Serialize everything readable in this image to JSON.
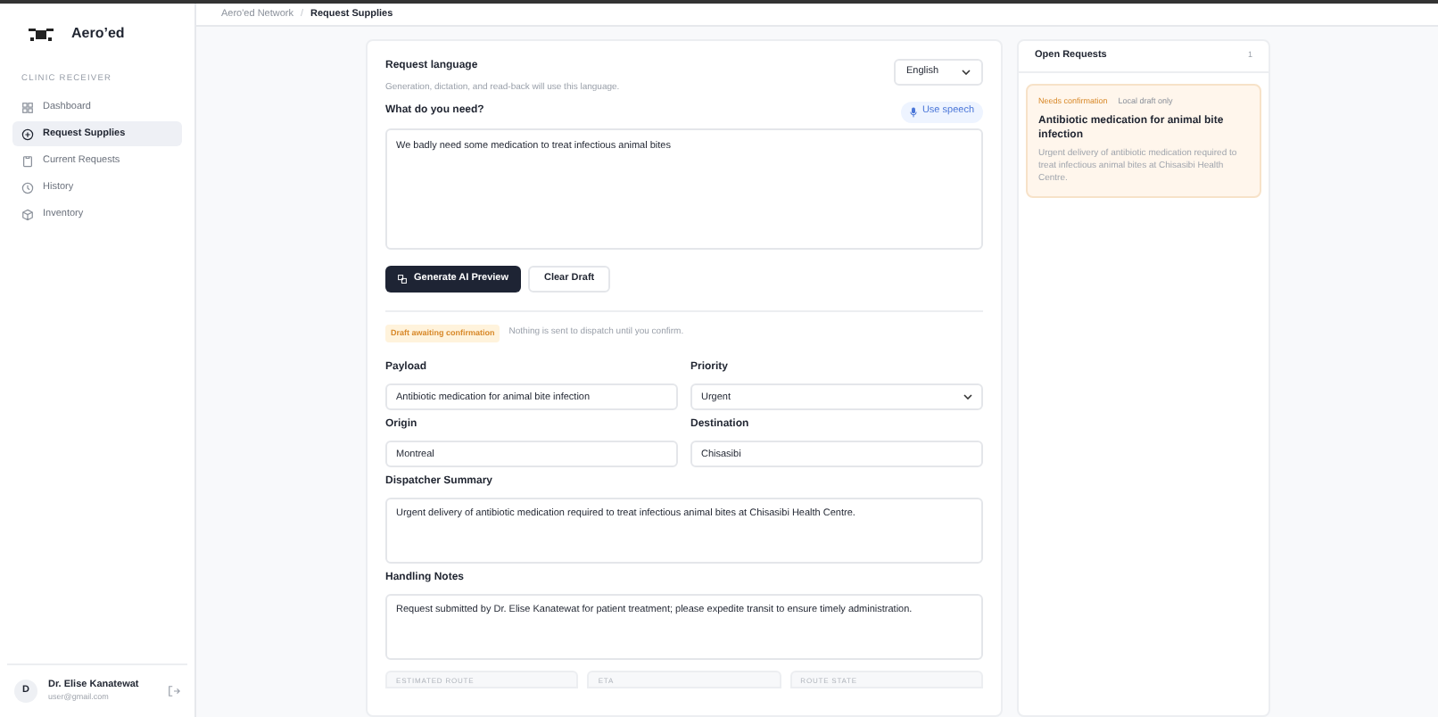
{
  "app": {
    "name": "Aero’ed"
  },
  "sidebar": {
    "section": "CLINIC RECEIVER",
    "items": [
      {
        "label": "Dashboard",
        "selected": false
      },
      {
        "label": "Request Supplies",
        "selected": true
      },
      {
        "label": "Current Requests",
        "selected": false
      },
      {
        "label": "History",
        "selected": false
      },
      {
        "label": "Inventory",
        "selected": false
      }
    ],
    "user": {
      "initial": "D",
      "name": "Dr. Elise Kanatewat",
      "email": "user@gmail.com"
    }
  },
  "breadcrumb": [
    "Aero'ed Network",
    "Request Supplies"
  ],
  "breadcrumb_separator": "/",
  "form": {
    "language": {
      "label": "Request language",
      "hint": "Generation, dictation, and read-back will use this language.",
      "value": "English"
    },
    "need": {
      "label": "What do you need?",
      "speech_button": "Use speech",
      "value": "We badly need some medication to treat infectious animal bites"
    },
    "buttons": {
      "primary": "Generate AI Preview",
      "secondary": "Clear Draft"
    },
    "status": {
      "badge": "Draft awaiting confirmation",
      "note": "Nothing is sent to dispatch until you confirm."
    },
    "fields": [
      {
        "kind": "input",
        "label": "Payload",
        "value": "Antibiotic medication for animal bite infection"
      },
      {
        "kind": "select",
        "label": "Priority",
        "value": "Urgent"
      },
      {
        "kind": "input",
        "label": "Origin",
        "value": "Montreal"
      },
      {
        "kind": "input",
        "label": "Destination",
        "value": "Chisasibi"
      },
      {
        "kind": "textarea",
        "label": "Dispatcher Summary",
        "value": "Urgent delivery of antibiotic medication required to treat infectious animal bites at Chisasibi Health Centre."
      },
      {
        "kind": "textarea",
        "label": "Handling Notes",
        "value": "Request submitted by Dr. Elise Kanatewat for patient treatment; please expedite transit to ensure timely administration."
      }
    ],
    "route_cards": [
      "ESTIMATED ROUTE",
      "ETA",
      "ROUTE STATE"
    ]
  },
  "open_requests": {
    "title": "Open Requests",
    "count": "1",
    "items": [
      {
        "status": "Needs confirmation",
        "scope": "Local draft only",
        "title": "Antibiotic medication for animal bite infection",
        "description": "Urgent delivery of antibiotic medication required to treat infectious animal bites at Chisasibi Health Centre."
      }
    ]
  }
}
